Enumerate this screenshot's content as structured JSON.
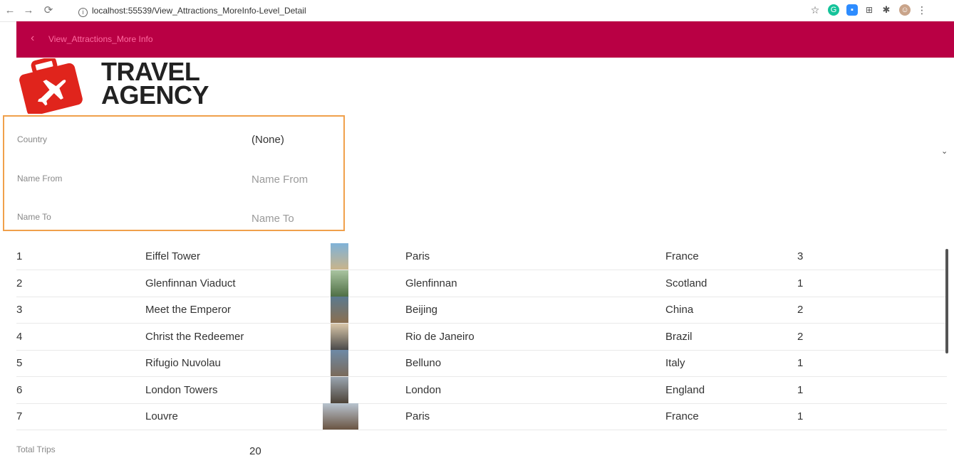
{
  "browser": {
    "url": "localhost:55539/View_Attractions_MoreInfo-Level_Detail"
  },
  "appbar": {
    "title": "View_Attractions_More Info"
  },
  "logo": {
    "line1": "TRAVEL",
    "line2": "AGENCY"
  },
  "filters": {
    "country_label": "Country",
    "country_value": "(None)",
    "name_from_label": "Name From",
    "name_from_placeholder": "Name From",
    "name_to_label": "Name To",
    "name_to_placeholder": "Name To"
  },
  "grid": {
    "rows": [
      {
        "id": "1",
        "name": "Eiffel Tower",
        "city": "Paris",
        "country": "France",
        "trips": "3"
      },
      {
        "id": "2",
        "name": "Glenfinnan Viaduct",
        "city": "Glenfinnan",
        "country": "Scotland",
        "trips": "1"
      },
      {
        "id": "3",
        "name": "Meet the Emperor",
        "city": "Beijing",
        "country": "China",
        "trips": "2"
      },
      {
        "id": "4",
        "name": "Christ the Redeemer",
        "city": "Rio de Janeiro",
        "country": "Brazil",
        "trips": "2"
      },
      {
        "id": "5",
        "name": "Rifugio Nuvolau",
        "city": "Belluno",
        "country": "Italy",
        "trips": "1"
      },
      {
        "id": "6",
        "name": "London Towers",
        "city": "London",
        "country": "England",
        "trips": "1"
      },
      {
        "id": "7",
        "name": "Louvre",
        "city": "Paris",
        "country": "France",
        "trips": "1"
      }
    ]
  },
  "footer": {
    "total_trips_label": "Total Trips",
    "total_trips_value": "20"
  },
  "colors": {
    "appbar": "#b90044",
    "appbar_text": "#ff6aa0",
    "highlight_border": "#f0a04b",
    "logo_red": "#e0241c"
  }
}
